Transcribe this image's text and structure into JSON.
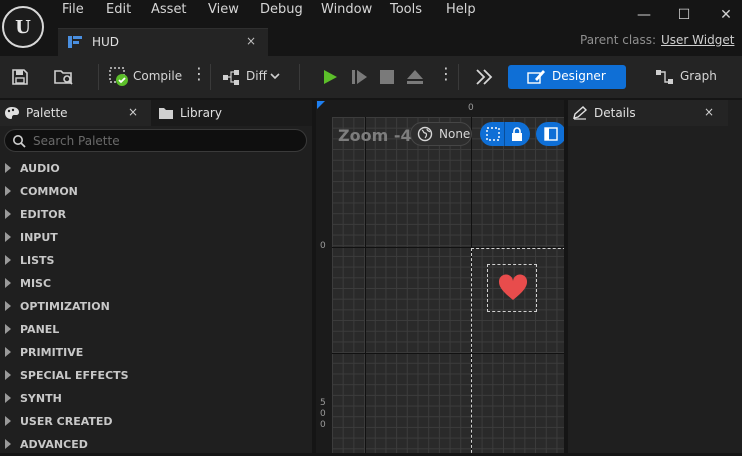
{
  "menu": [
    "File",
    "Edit",
    "Asset",
    "View",
    "Debug",
    "Window",
    "Tools",
    "Help"
  ],
  "window_controls": {
    "minimize": "—",
    "maximize": "☐",
    "close": "✕"
  },
  "logo_text": "U",
  "document_tab": {
    "label": "HUD",
    "close": "×"
  },
  "parent_class": {
    "label": "Parent class:",
    "value": "User Widget"
  },
  "toolbar": {
    "compile_label": "Compile",
    "diff_label": "Diff",
    "designer_label": "Designer",
    "graph_label": "Graph"
  },
  "palette": {
    "tab_label": "Palette",
    "tab_close": "×",
    "library_label": "Library",
    "search_placeholder": "Search Palette",
    "categories": [
      "AUDIO",
      "COMMON",
      "EDITOR",
      "INPUT",
      "LISTS",
      "MISC",
      "OPTIMIZATION",
      "PANEL",
      "PRIMITIVE",
      "SPECIAL EFFECTS",
      "SYNTH",
      "USER CREATED",
      "ADVANCED"
    ]
  },
  "viewport": {
    "zoom_label": "Zoom -4",
    "dpi_none_label": "None",
    "ruler_top_zero": "0",
    "ruler_left_zero": "0",
    "ruler_left_500": [
      "5",
      "0",
      "0"
    ]
  },
  "details": {
    "tab_label": "Details",
    "close": "×"
  },
  "colors": {
    "accent": "#0f6fd6",
    "heart": "#e84c4c",
    "play": "#5cbf2a"
  }
}
